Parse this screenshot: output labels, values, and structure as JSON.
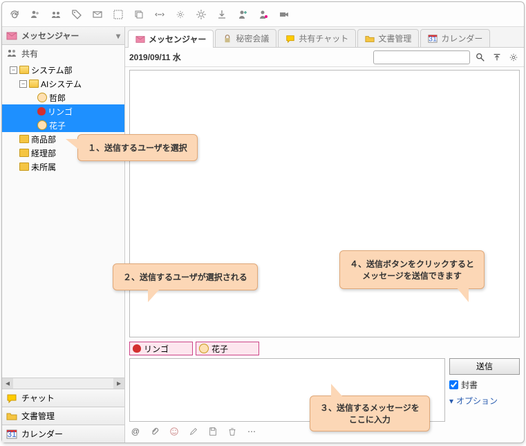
{
  "sidebar": {
    "header": "メッセンジャー",
    "share_label": "共有",
    "tree": {
      "system": "システム部",
      "ai": "AIシステム",
      "user1": "哲郎",
      "user2": "リンゴ",
      "user3": "花子",
      "shouhin": "商品部",
      "keiri": "経理部",
      "misyozoku": "未所属"
    },
    "nav": {
      "chat": "チャット",
      "docs": "文書管理",
      "calendar": "カレンダー"
    },
    "cal_day": "31"
  },
  "tabs": {
    "messenger": "メッセンジャー",
    "secret": "秘密会議",
    "shared_chat": "共有チャット",
    "docs": "文書管理",
    "calendar": "カレンダー",
    "cal_day": "31"
  },
  "date": "2019/09/11 水",
  "recipients": {
    "r1": "リンゴ",
    "r2": "花子"
  },
  "compose": {
    "send": "送信",
    "sealed": "封書",
    "options": "オプション"
  },
  "callouts": {
    "c1": "１、送信するユーザを選択",
    "c2": "２、送信するユーザが選択される",
    "c3a": "３、送信するメッセージを",
    "c3b": "ここに入力",
    "c4a": "４、送信ボタンをクリックすると",
    "c4b": "メッセージを送信できます"
  }
}
